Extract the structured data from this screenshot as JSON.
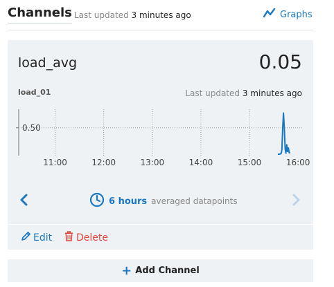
{
  "header": {
    "title": "Channels",
    "last_updated_label": "Last updated",
    "last_updated_time": "3 minutes ago",
    "graphs_label": "Graphs"
  },
  "channel": {
    "name": "load_avg",
    "value": "0.05",
    "series_name": "load_01",
    "last_updated_label": "Last updated",
    "last_updated_time": "3 minutes ago"
  },
  "range": {
    "label": "6 hours",
    "note": "averaged datapoints"
  },
  "actions": {
    "edit_label": "Edit",
    "delete_label": "Delete",
    "add_channel_label": "Add Channel"
  },
  "colors": {
    "accent": "#1a78c2",
    "danger": "#e0463a",
    "card_bg": "#eef2f5",
    "line": "#1a78c2"
  },
  "icons": {
    "graphs": "line-chart-icon",
    "prev": "chevron-left-icon",
    "next": "chevron-right-icon",
    "range": "clock-icon",
    "edit": "pencil-icon",
    "delete": "trash-icon",
    "add": "plus-icon"
  },
  "chart_data": {
    "type": "line",
    "series": [
      {
        "name": "load_01",
        "x": [
          "15:35",
          "15:37",
          "15:39",
          "15:40",
          "15:41",
          "15:42",
          "15:43",
          "15:44",
          "15:45",
          "15:46",
          "15:47",
          "15:48",
          "15:49",
          "15:50"
        ],
        "values": [
          0.0,
          0.0,
          0.01,
          0.08,
          0.5,
          0.78,
          0.5,
          0.1,
          0.02,
          0.18,
          0.05,
          0.12,
          0.03,
          0.02
        ]
      }
    ],
    "y_ticks": [
      "0.50"
    ],
    "x_ticks": [
      "11:00",
      "12:00",
      "13:00",
      "14:00",
      "15:00",
      "16:00"
    ],
    "ylim": [
      0,
      0.85
    ],
    "xlim": [
      "10:15",
      "16:05"
    ],
    "grid": true
  }
}
